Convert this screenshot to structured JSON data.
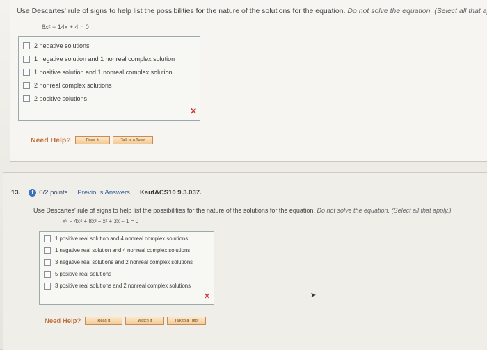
{
  "q12": {
    "prompt": "Use Descartes' rule of signs to help list the possibilities for the nature of the solutions for the equation.",
    "prompt_note": "Do not solve the equation.",
    "select_hint": "(Select all that apply.)",
    "equation": "8x² − 14x + 4 = 0",
    "options": [
      "2 negative solutions",
      "1 negative solution and 1 nonreal complex solution",
      "1 positive solution and 1 nonreal complex solution",
      "2 nonreal complex solutions",
      "2 positive solutions"
    ],
    "feedback_icon": "x-icon",
    "need_help": "Need Help?",
    "help_buttons": [
      "Read It",
      "Talk to a Tutor"
    ]
  },
  "q13": {
    "number": "13.",
    "points": "0/2 points",
    "previous_answers": "Previous Answers",
    "reference": "KaufACS10 9.3.037.",
    "prompt": "Use Descartes' rule of signs to help list the possibilities for the nature of the solutions for the equation.",
    "prompt_note": "Do not solve the equation.",
    "select_hint": "(Select all that apply.)",
    "equation": "x⁵ − 4x⁴ + 8x³ − x² + 3x − 1 = 0",
    "options": [
      "1 positive real solution and 4 nonreal complex solutions",
      "1 negative real solution and 4 nonreal complex solutions",
      "3 negative real solutions and 2 nonreal complex solutions",
      "5 positive real solutions",
      "3 positive real solutions and 2 nonreal complex solutions"
    ],
    "feedback_icon": "x-icon",
    "need_help": "Need Help?",
    "help_buttons": [
      "Read It",
      "Watch It",
      "Talk to a Tutor"
    ]
  },
  "colors": {
    "wrong": "#d23a3a",
    "help_label": "#c4703a",
    "link": "#2f5b97",
    "points_icon": "#3a74b8"
  }
}
